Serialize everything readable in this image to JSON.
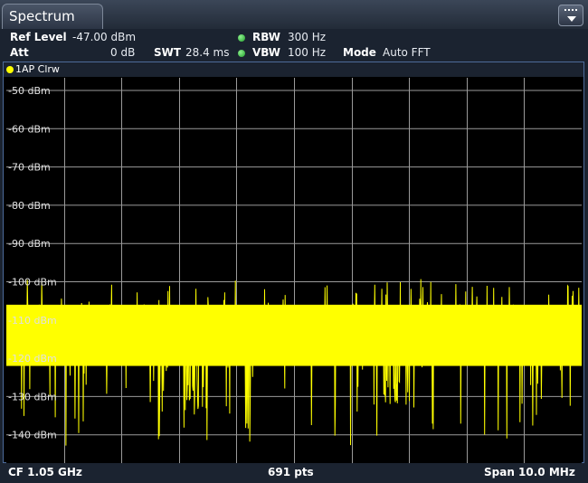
{
  "window": {
    "tab_title": "Spectrum"
  },
  "settings": {
    "ref_level_label": "Ref Level",
    "ref_level_value": "-47.00 dBm",
    "att_label": "Att",
    "att_value": "0 dB",
    "swt_label": "SWT",
    "swt_value": "28.4 ms",
    "rbw_label": "RBW",
    "rbw_value": "300 Hz",
    "vbw_label": "VBW",
    "vbw_value": "100 Hz",
    "mode_label": "Mode",
    "mode_value": "Auto FFT"
  },
  "trace": {
    "label": "1AP Clrw",
    "color": "#ffff00"
  },
  "footer": {
    "cf": "CF 1.05 GHz",
    "points": "691 pts",
    "span": "Span 10.0 MHz"
  },
  "chart_data": {
    "type": "line",
    "y_tick_labels": [
      "-50 dBm",
      "-60 dBm",
      "-70 dBm",
      "-80 dBm",
      "-90 dBm",
      "-100 dBm",
      "-110 dBm",
      "-120 dBm",
      "-130 dBm",
      "-140 dBm"
    ],
    "ylim": [
      -150,
      -47
    ],
    "xlim": [
      1045,
      1055
    ],
    "x_unit": "MHz",
    "points": 691,
    "grid": true,
    "series": [
      {
        "color": "#ffff00",
        "noise_floor_upper_dbm": -107,
        "noise_floor_lower_dbm": -121,
        "peak_max_dbm": -99,
        "valley_min_dbm": -143
      }
    ]
  }
}
